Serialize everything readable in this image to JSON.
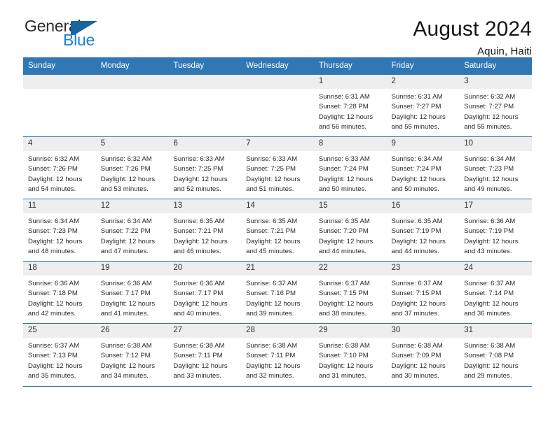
{
  "brand": {
    "name_part1": "General",
    "name_part2": "Blue",
    "logo_icon": "triangle-flag-icon",
    "accent_color": "#1c7fd4",
    "header_color": "#2f77b5"
  },
  "header": {
    "title": "August 2024",
    "subtitle": "Aquin, Haiti"
  },
  "weekday_headers": [
    "Sunday",
    "Monday",
    "Tuesday",
    "Wednesday",
    "Thursday",
    "Friday",
    "Saturday"
  ],
  "labels": {
    "sunrise_prefix": "Sunrise:",
    "sunset_prefix": "Sunset:",
    "daylight_prefix": "Daylight:"
  },
  "weeks": [
    [
      {
        "day": "",
        "empty": true
      },
      {
        "day": "",
        "empty": true
      },
      {
        "day": "",
        "empty": true
      },
      {
        "day": "",
        "empty": true
      },
      {
        "day": "1",
        "sunrise": "Sunrise: 6:31 AM",
        "sunset": "Sunset: 7:28 PM",
        "daylight_line1": "Daylight: 12 hours",
        "daylight_line2": "and 56 minutes."
      },
      {
        "day": "2",
        "sunrise": "Sunrise: 6:31 AM",
        "sunset": "Sunset: 7:27 PM",
        "daylight_line1": "Daylight: 12 hours",
        "daylight_line2": "and 55 minutes."
      },
      {
        "day": "3",
        "sunrise": "Sunrise: 6:32 AM",
        "sunset": "Sunset: 7:27 PM",
        "daylight_line1": "Daylight: 12 hours",
        "daylight_line2": "and 55 minutes."
      }
    ],
    [
      {
        "day": "4",
        "sunrise": "Sunrise: 6:32 AM",
        "sunset": "Sunset: 7:26 PM",
        "daylight_line1": "Daylight: 12 hours",
        "daylight_line2": "and 54 minutes."
      },
      {
        "day": "5",
        "sunrise": "Sunrise: 6:32 AM",
        "sunset": "Sunset: 7:26 PM",
        "daylight_line1": "Daylight: 12 hours",
        "daylight_line2": "and 53 minutes."
      },
      {
        "day": "6",
        "sunrise": "Sunrise: 6:33 AM",
        "sunset": "Sunset: 7:25 PM",
        "daylight_line1": "Daylight: 12 hours",
        "daylight_line2": "and 52 minutes."
      },
      {
        "day": "7",
        "sunrise": "Sunrise: 6:33 AM",
        "sunset": "Sunset: 7:25 PM",
        "daylight_line1": "Daylight: 12 hours",
        "daylight_line2": "and 51 minutes."
      },
      {
        "day": "8",
        "sunrise": "Sunrise: 6:33 AM",
        "sunset": "Sunset: 7:24 PM",
        "daylight_line1": "Daylight: 12 hours",
        "daylight_line2": "and 50 minutes."
      },
      {
        "day": "9",
        "sunrise": "Sunrise: 6:34 AM",
        "sunset": "Sunset: 7:24 PM",
        "daylight_line1": "Daylight: 12 hours",
        "daylight_line2": "and 50 minutes."
      },
      {
        "day": "10",
        "sunrise": "Sunrise: 6:34 AM",
        "sunset": "Sunset: 7:23 PM",
        "daylight_line1": "Daylight: 12 hours",
        "daylight_line2": "and 49 minutes."
      }
    ],
    [
      {
        "day": "11",
        "sunrise": "Sunrise: 6:34 AM",
        "sunset": "Sunset: 7:23 PM",
        "daylight_line1": "Daylight: 12 hours",
        "daylight_line2": "and 48 minutes."
      },
      {
        "day": "12",
        "sunrise": "Sunrise: 6:34 AM",
        "sunset": "Sunset: 7:22 PM",
        "daylight_line1": "Daylight: 12 hours",
        "daylight_line2": "and 47 minutes."
      },
      {
        "day": "13",
        "sunrise": "Sunrise: 6:35 AM",
        "sunset": "Sunset: 7:21 PM",
        "daylight_line1": "Daylight: 12 hours",
        "daylight_line2": "and 46 minutes."
      },
      {
        "day": "14",
        "sunrise": "Sunrise: 6:35 AM",
        "sunset": "Sunset: 7:21 PM",
        "daylight_line1": "Daylight: 12 hours",
        "daylight_line2": "and 45 minutes."
      },
      {
        "day": "15",
        "sunrise": "Sunrise: 6:35 AM",
        "sunset": "Sunset: 7:20 PM",
        "daylight_line1": "Daylight: 12 hours",
        "daylight_line2": "and 44 minutes."
      },
      {
        "day": "16",
        "sunrise": "Sunrise: 6:35 AM",
        "sunset": "Sunset: 7:19 PM",
        "daylight_line1": "Daylight: 12 hours",
        "daylight_line2": "and 44 minutes."
      },
      {
        "day": "17",
        "sunrise": "Sunrise: 6:36 AM",
        "sunset": "Sunset: 7:19 PM",
        "daylight_line1": "Daylight: 12 hours",
        "daylight_line2": "and 43 minutes."
      }
    ],
    [
      {
        "day": "18",
        "sunrise": "Sunrise: 6:36 AM",
        "sunset": "Sunset: 7:18 PM",
        "daylight_line1": "Daylight: 12 hours",
        "daylight_line2": "and 42 minutes."
      },
      {
        "day": "19",
        "sunrise": "Sunrise: 6:36 AM",
        "sunset": "Sunset: 7:17 PM",
        "daylight_line1": "Daylight: 12 hours",
        "daylight_line2": "and 41 minutes."
      },
      {
        "day": "20",
        "sunrise": "Sunrise: 6:36 AM",
        "sunset": "Sunset: 7:17 PM",
        "daylight_line1": "Daylight: 12 hours",
        "daylight_line2": "and 40 minutes."
      },
      {
        "day": "21",
        "sunrise": "Sunrise: 6:37 AM",
        "sunset": "Sunset: 7:16 PM",
        "daylight_line1": "Daylight: 12 hours",
        "daylight_line2": "and 39 minutes."
      },
      {
        "day": "22",
        "sunrise": "Sunrise: 6:37 AM",
        "sunset": "Sunset: 7:15 PM",
        "daylight_line1": "Daylight: 12 hours",
        "daylight_line2": "and 38 minutes."
      },
      {
        "day": "23",
        "sunrise": "Sunrise: 6:37 AM",
        "sunset": "Sunset: 7:15 PM",
        "daylight_line1": "Daylight: 12 hours",
        "daylight_line2": "and 37 minutes."
      },
      {
        "day": "24",
        "sunrise": "Sunrise: 6:37 AM",
        "sunset": "Sunset: 7:14 PM",
        "daylight_line1": "Daylight: 12 hours",
        "daylight_line2": "and 36 minutes."
      }
    ],
    [
      {
        "day": "25",
        "sunrise": "Sunrise: 6:37 AM",
        "sunset": "Sunset: 7:13 PM",
        "daylight_line1": "Daylight: 12 hours",
        "daylight_line2": "and 35 minutes."
      },
      {
        "day": "26",
        "sunrise": "Sunrise: 6:38 AM",
        "sunset": "Sunset: 7:12 PM",
        "daylight_line1": "Daylight: 12 hours",
        "daylight_line2": "and 34 minutes."
      },
      {
        "day": "27",
        "sunrise": "Sunrise: 6:38 AM",
        "sunset": "Sunset: 7:11 PM",
        "daylight_line1": "Daylight: 12 hours",
        "daylight_line2": "and 33 minutes."
      },
      {
        "day": "28",
        "sunrise": "Sunrise: 6:38 AM",
        "sunset": "Sunset: 7:11 PM",
        "daylight_line1": "Daylight: 12 hours",
        "daylight_line2": "and 32 minutes."
      },
      {
        "day": "29",
        "sunrise": "Sunrise: 6:38 AM",
        "sunset": "Sunset: 7:10 PM",
        "daylight_line1": "Daylight: 12 hours",
        "daylight_line2": "and 31 minutes."
      },
      {
        "day": "30",
        "sunrise": "Sunrise: 6:38 AM",
        "sunset": "Sunset: 7:09 PM",
        "daylight_line1": "Daylight: 12 hours",
        "daylight_line2": "and 30 minutes."
      },
      {
        "day": "31",
        "sunrise": "Sunrise: 6:38 AM",
        "sunset": "Sunset: 7:08 PM",
        "daylight_line1": "Daylight: 12 hours",
        "daylight_line2": "and 29 minutes."
      }
    ]
  ]
}
